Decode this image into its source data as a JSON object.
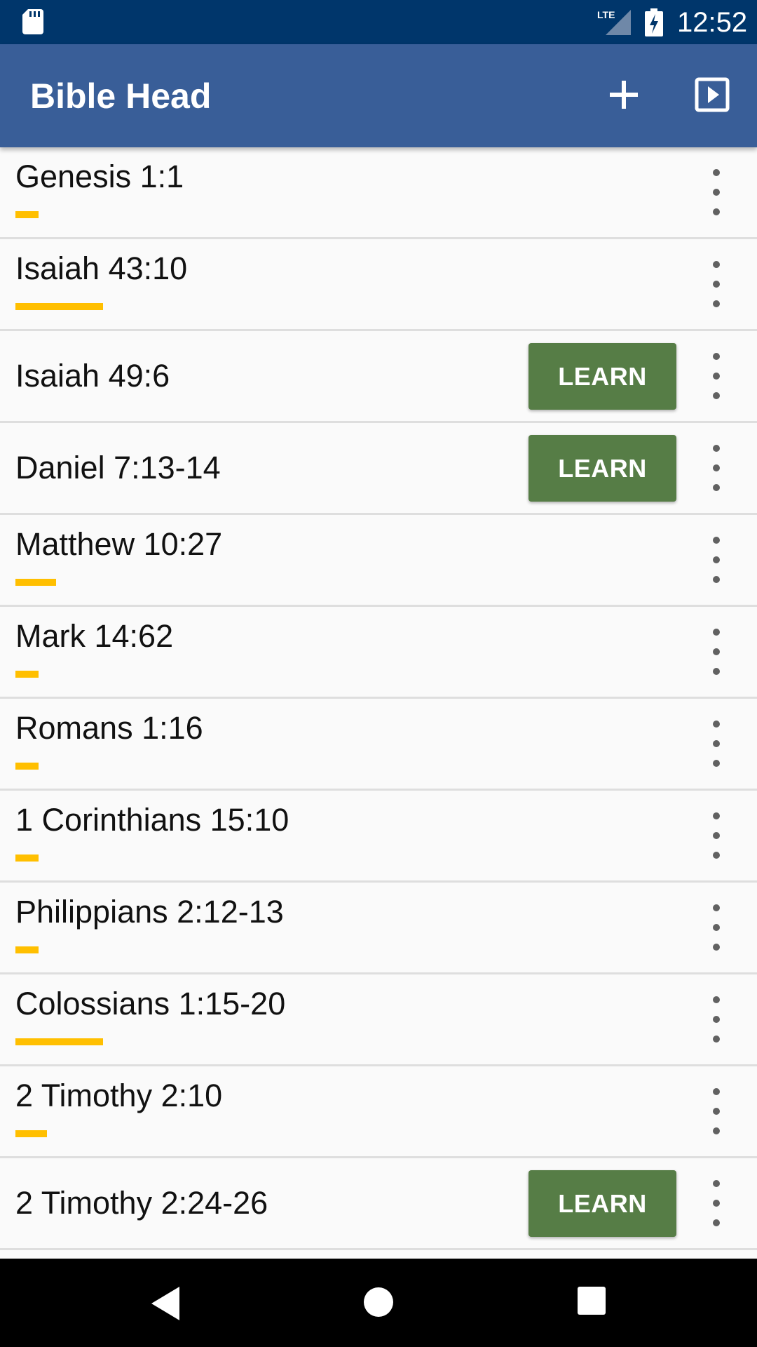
{
  "status_bar": {
    "network": "LTE",
    "time": "12:52"
  },
  "app_bar": {
    "title": "Bible Head",
    "actions": [
      "add-icon",
      "play-icon"
    ]
  },
  "colors": {
    "status_bar": "#00366b",
    "app_bar": "#395e98",
    "learn_button": "#567d46",
    "progress": "#ffbf00",
    "background": "#fafafa"
  },
  "verses": [
    {
      "reference": "Genesis 1:1",
      "progress": 0.2,
      "learn_label": ""
    },
    {
      "reference": "Isaiah 43:10",
      "progress": 0.75,
      "learn_label": ""
    },
    {
      "reference": "Isaiah 49:6",
      "progress": 0,
      "learn_label": "LEARN"
    },
    {
      "reference": "Daniel 7:13-14",
      "progress": 0,
      "learn_label": "LEARN"
    },
    {
      "reference": "Matthew 10:27",
      "progress": 0.35,
      "learn_label": ""
    },
    {
      "reference": "Mark 14:62",
      "progress": 0.2,
      "learn_label": ""
    },
    {
      "reference": "Romans 1:16",
      "progress": 0.2,
      "learn_label": ""
    },
    {
      "reference": "1 Corinthians 15:10",
      "progress": 0.2,
      "learn_label": ""
    },
    {
      "reference": "Philippians 2:12-13",
      "progress": 0.2,
      "learn_label": ""
    },
    {
      "reference": "Colossians 1:15-20",
      "progress": 0.75,
      "learn_label": ""
    },
    {
      "reference": "2 Timothy 2:10",
      "progress": 0.27,
      "learn_label": ""
    },
    {
      "reference": "2 Timothy 2:24-26",
      "progress": 0,
      "learn_label": "LEARN"
    },
    {
      "reference": "",
      "progress": 0,
      "learn_label": " "
    }
  ]
}
